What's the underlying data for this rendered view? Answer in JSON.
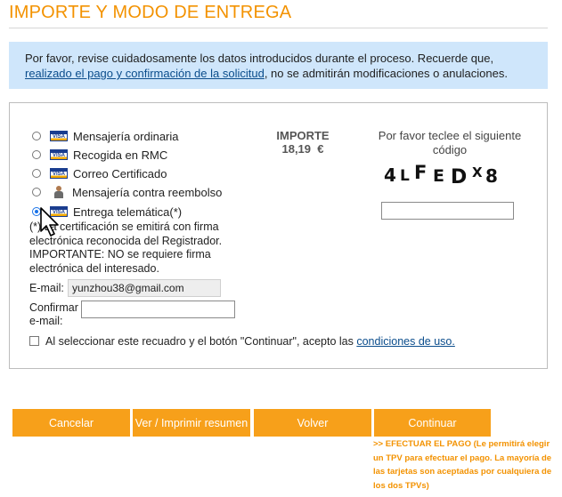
{
  "page_title": "IMPORTE Y MODO DE ENTREGA",
  "notice": {
    "text_before": "Por favor, revise cuidadosamente los datos introducidos durante el proceso. Recuerde que, ",
    "link_text": "realizado el pago y confirmación de la solicitud",
    "text_after": ", no se admitirán modificaciones o anulaciones."
  },
  "delivery_options": [
    {
      "label": "Mensajería ordinaria",
      "icon": "visa-card-icon",
      "selected": false
    },
    {
      "label": "Recogida en RMC",
      "icon": "visa-card-icon",
      "selected": false
    },
    {
      "label": "Correo Certificado",
      "icon": "visa-card-icon",
      "selected": false
    },
    {
      "label": "Mensajería contra reembolso",
      "icon": "person-icon",
      "selected": false
    },
    {
      "label": "Entrega telemática(*)",
      "icon": "visa-card-icon",
      "selected": true
    }
  ],
  "note": {
    "line1": "(*) La certificación se emitirá con firma electrónica reconocida del Registrador.",
    "line2": "IMPORTANTE: NO se requiere firma electrónica del interesado."
  },
  "importe": {
    "label": "IMPORTE",
    "value": "18,19",
    "currency": "€"
  },
  "captcha": {
    "prompt": "Por favor teclee el siguiente código",
    "code": "4LFEDX8"
  },
  "email": {
    "label": "E-mail:",
    "value": "yunzhou38@gmail.com"
  },
  "confirm_email": {
    "label_line1": "Confirmar",
    "label_line2": "e-mail:",
    "value": ""
  },
  "terms": {
    "text": "Al seleccionar este recuadro y el botón \"Continuar\", acepto las ",
    "link_text": "condiciones de uso.",
    "checked": false
  },
  "buttons": {
    "cancel": "Cancelar",
    "print": "Ver / Imprimir resumen",
    "back": "Volver",
    "continue": "Continuar"
  },
  "pay_note": ">> EFECTUAR EL PAGO (Le permitirá elegir un TPV para efectuar el pago. La mayoría de las tarjetas son aceptadas por cualquiera de los dos TPVs)",
  "colors": {
    "accent": "#f39200",
    "button": "#f7a01a",
    "notice_bg": "#cfe6fb",
    "link": "#0b4d8c"
  }
}
